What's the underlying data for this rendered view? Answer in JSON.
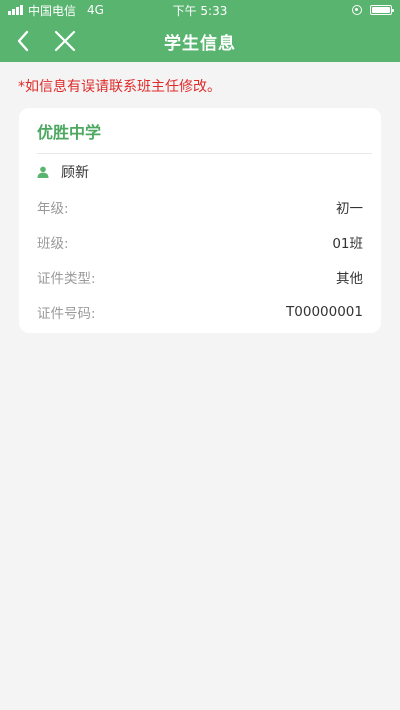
{
  "status_bar": {
    "carrier": "中国电信",
    "network": "4G",
    "time": "下午 5:33"
  },
  "nav": {
    "title": "学生信息",
    "back_icon": "chevron-left-icon",
    "close_icon": "close-icon"
  },
  "notice": "*如信息有误请联系班主任修改。",
  "card": {
    "school": "优胜中学",
    "student_name": "顾新",
    "rows": [
      {
        "label": "年级:",
        "value": "初一"
      },
      {
        "label": "班级:",
        "value": "01班"
      },
      {
        "label": "证件类型:",
        "value": "其他"
      },
      {
        "label": "证件号码:",
        "value": "T00000001"
      }
    ]
  },
  "colors": {
    "brand_green": "#58b46f",
    "school_green": "#4ca860",
    "notice_red": "#e02b2b",
    "background": "#f4f4f4"
  }
}
